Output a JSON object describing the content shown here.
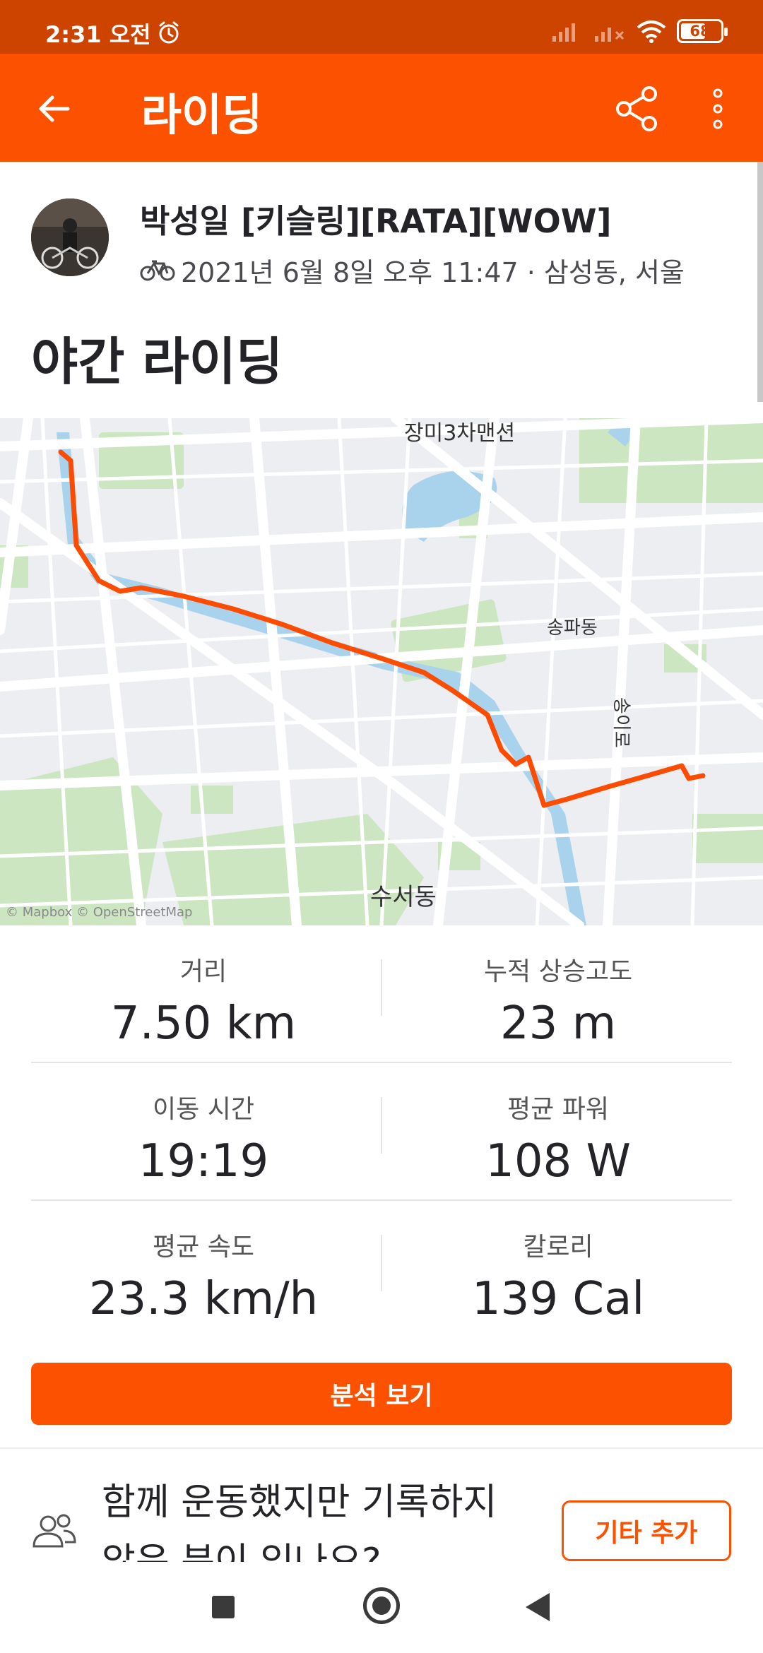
{
  "status_bar": {
    "time": "2:31 오전",
    "battery": "68",
    "icons": [
      "alarm-icon",
      "signal-icon",
      "wifi-icon",
      "battery-icon"
    ]
  },
  "app_bar": {
    "title": "라이딩",
    "icons": [
      "back-arrow-icon",
      "share-icon",
      "more-vert-icon"
    ]
  },
  "activity": {
    "athlete": "박성일 [키슬링][RATA][WOW]",
    "meta": "2021년 6월 8일 오후 11:47 · 삼성동, 서울",
    "sport_icon": "bike-icon",
    "title": "야간 라이딩"
  },
  "map": {
    "labels": {
      "top": "장미3차맨션",
      "songpa": "송파동",
      "road": "송이로",
      "suseo": "수서동"
    },
    "attribution": "© Mapbox © OpenStreetMap",
    "route_color": "#fc4c02"
  },
  "stats": [
    {
      "label": "거리",
      "value": "7.50 km"
    },
    {
      "label": "누적 상승고도",
      "value": "23 m"
    },
    {
      "label": "이동 시간",
      "value": "19:19"
    },
    {
      "label": "평균 파워",
      "value": "108 W"
    },
    {
      "label": "평균 속도",
      "value": "23.3 km/h"
    },
    {
      "label": "칼로리",
      "value": "139 Cal"
    }
  ],
  "analyze_button": "분석 보기",
  "invite": {
    "text": "함께 운동했지만 기록하지 않은 분이 있나요?",
    "button": "기타 추가"
  },
  "colors": {
    "brand": "#fc5200",
    "status_bar": "#cc4400"
  }
}
